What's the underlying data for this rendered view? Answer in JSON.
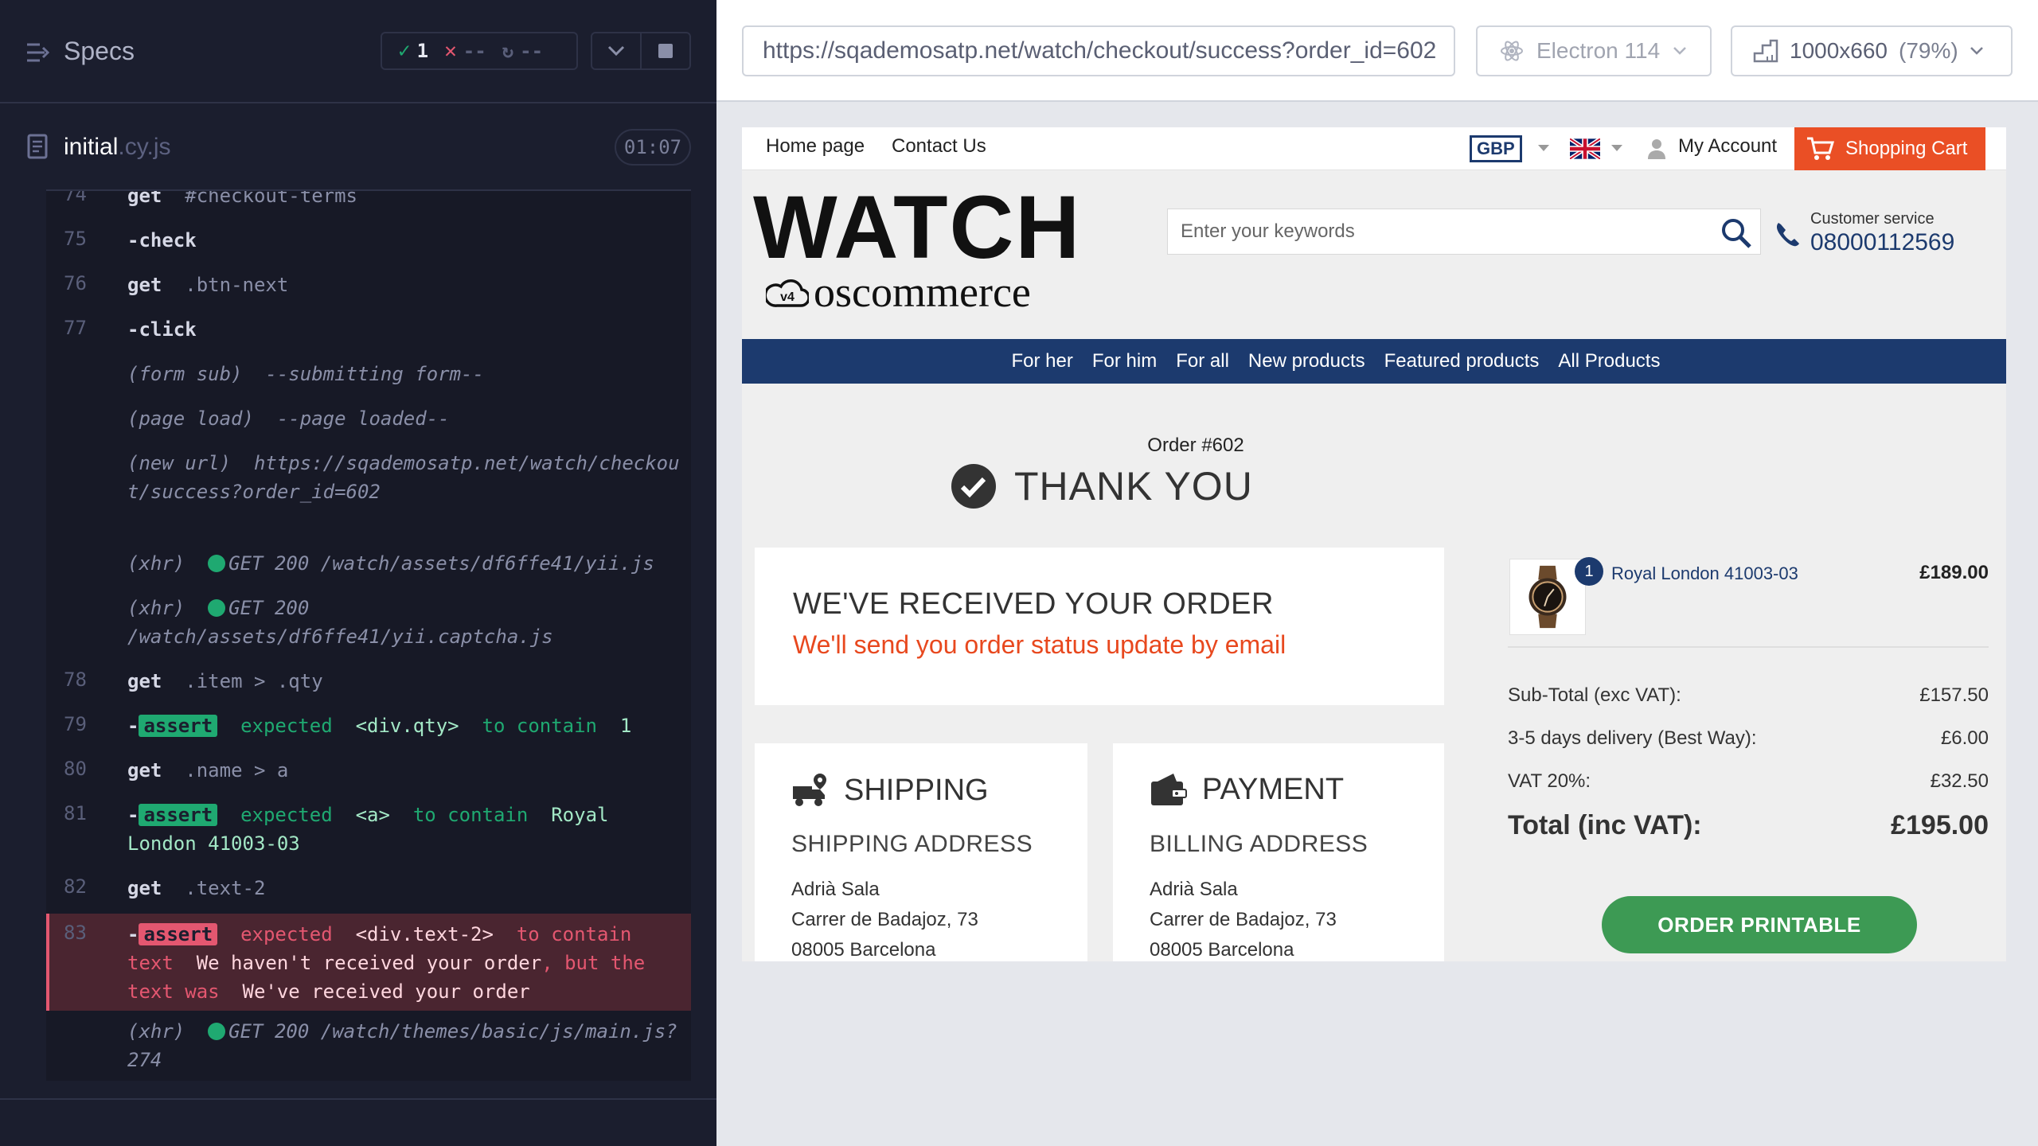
{
  "reporter": {
    "title": "Specs",
    "stats": {
      "passed": "1",
      "failed": "--",
      "pending": "--"
    },
    "spec_file": {
      "name": "initial",
      "ext": ".cy.js",
      "duration": "01:07"
    },
    "commands": [
      {
        "num": "74",
        "name": "get",
        "arg": "#checkout-terms"
      },
      {
        "num": "75",
        "name": "-check",
        "arg": ""
      },
      {
        "num": "76",
        "name": "get",
        "arg": ".btn-next"
      },
      {
        "num": "77",
        "name": "-click",
        "arg": ""
      },
      {
        "num": "",
        "event": "(form sub)",
        "text": "--submitting form--"
      },
      {
        "num": "",
        "event": "(page load)",
        "text": "--page loaded--"
      },
      {
        "num": "",
        "event": "(new url)",
        "text": "https://sqademosatp.net/watch/checkout/success?order_id=602"
      },
      {
        "num": "",
        "event": "(xhr)",
        "text": "GET 200 /watch/assets/df6ffe41/yii.js"
      },
      {
        "num": "",
        "event": "(xhr)",
        "text": "GET 200 /watch/assets/df6ffe41/yii.captcha.js"
      },
      {
        "num": "78",
        "name": "get",
        "arg": ".item > .qty"
      },
      {
        "num": "79",
        "assert": "assert",
        "parts": [
          "expected",
          "<div.qty>",
          "to contain",
          "1"
        ]
      },
      {
        "num": "80",
        "name": "get",
        "arg": ".name > a"
      },
      {
        "num": "81",
        "assert": "assert",
        "parts": [
          "expected",
          "<a>",
          "to contain",
          "Royal London 41003-03"
        ]
      },
      {
        "num": "82",
        "name": "get",
        "arg": ".text-2"
      },
      {
        "num": "83",
        "assert": "assert",
        "parts": [
          "expected",
          "<div.text-2>",
          "to contain text",
          "We haven't received your order",
          ", but the text was",
          "We've received your order"
        ]
      },
      {
        "num": "",
        "event": "(xhr)",
        "text": "GET 200 /watch/themes/basic/js/main.js?274"
      }
    ]
  },
  "aut": {
    "url": "https://sqademosatp.net/watch/checkout/success?order_id=602",
    "browser": "Electron 114",
    "viewport": "1000x660",
    "scale": "(79%)"
  },
  "site": {
    "top_links": [
      "Home page",
      "Contact Us"
    ],
    "currency": "GBP",
    "account": "My Account",
    "cart": "Shopping Cart",
    "logo_main": "WATCH",
    "logo_sub": "oscommerce",
    "logo_badge": "v4",
    "search_placeholder": "Enter your keywords",
    "cs_label": "Customer service",
    "cs_phone": "08000112569",
    "menu": [
      "For her",
      "For him",
      "For all",
      "New products",
      "Featured products",
      "All Products"
    ],
    "order_number": "Order #602",
    "thank_you": "THANK YOU",
    "received_title": "WE'VE RECEIVED YOUR ORDER",
    "received_sub": "We'll send you order status update by email",
    "shipping": {
      "title": "SHIPPING",
      "subtitle": "SHIPPING ADDRESS",
      "lines": [
        "Adrià Sala",
        "Carrer de Badajoz, 73",
        "08005 Barcelona"
      ]
    },
    "payment": {
      "title": "PAYMENT",
      "subtitle": "BILLING ADDRESS",
      "lines": [
        "Adrià Sala",
        "Carrer de Badajoz, 73",
        "08005 Barcelona"
      ]
    },
    "product": {
      "qty": "1",
      "name": "Royal London 41003-03",
      "price": "£189.00"
    },
    "summary": [
      {
        "label": "Sub-Total (exc VAT):",
        "value": "£157.50"
      },
      {
        "label": "3-5 days delivery (Best Way):",
        "value": "£6.00"
      },
      {
        "label": "VAT 20%:",
        "value": "£32.50"
      }
    ],
    "total": {
      "label": "Total (inc VAT):",
      "value": "£195.00"
    },
    "print_button": "ORDER PRINTABLE"
  },
  "colors": {
    "reporter_bg": "#1b1e2e",
    "pass": "#1fa971",
    "fail": "#e45770",
    "brand_navy": "#1c3a6e",
    "cart_orange": "#ea4f25",
    "print_green": "#3d9a54"
  }
}
